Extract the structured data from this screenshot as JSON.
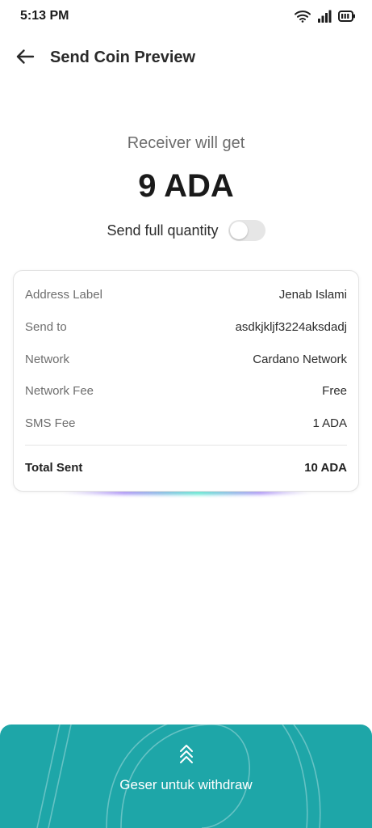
{
  "status_bar": {
    "time": "5:13 PM",
    "icons": [
      "wifi-icon",
      "signal-icon",
      "battery-icon"
    ]
  },
  "header": {
    "title": "Send Coin Preview",
    "back_icon": "arrow-left-icon"
  },
  "summary": {
    "receiver_label": "Receiver will get",
    "amount": "9 ADA",
    "full_quantity_label": "Send full quantity",
    "full_quantity_enabled": false
  },
  "details": {
    "rows": [
      {
        "label": "Address Label",
        "value": "Jenab Islami"
      },
      {
        "label": "Send to",
        "value": "asdkjkljf3224aksdadj"
      },
      {
        "label": "Network",
        "value": "Cardano Network"
      },
      {
        "label": "Network Fee",
        "value": "Free"
      },
      {
        "label": "SMS Fee",
        "value": "1 ADA"
      }
    ],
    "total_label": "Total Sent",
    "total_value": "10 ADA"
  },
  "swipe": {
    "label": "Geser untuk withdraw",
    "icon": "chevrons-up-icon"
  },
  "colors": {
    "accent": "#1ea6a8",
    "toggle_off": "#e6e6e6",
    "card_border": "#e2e2e2"
  }
}
